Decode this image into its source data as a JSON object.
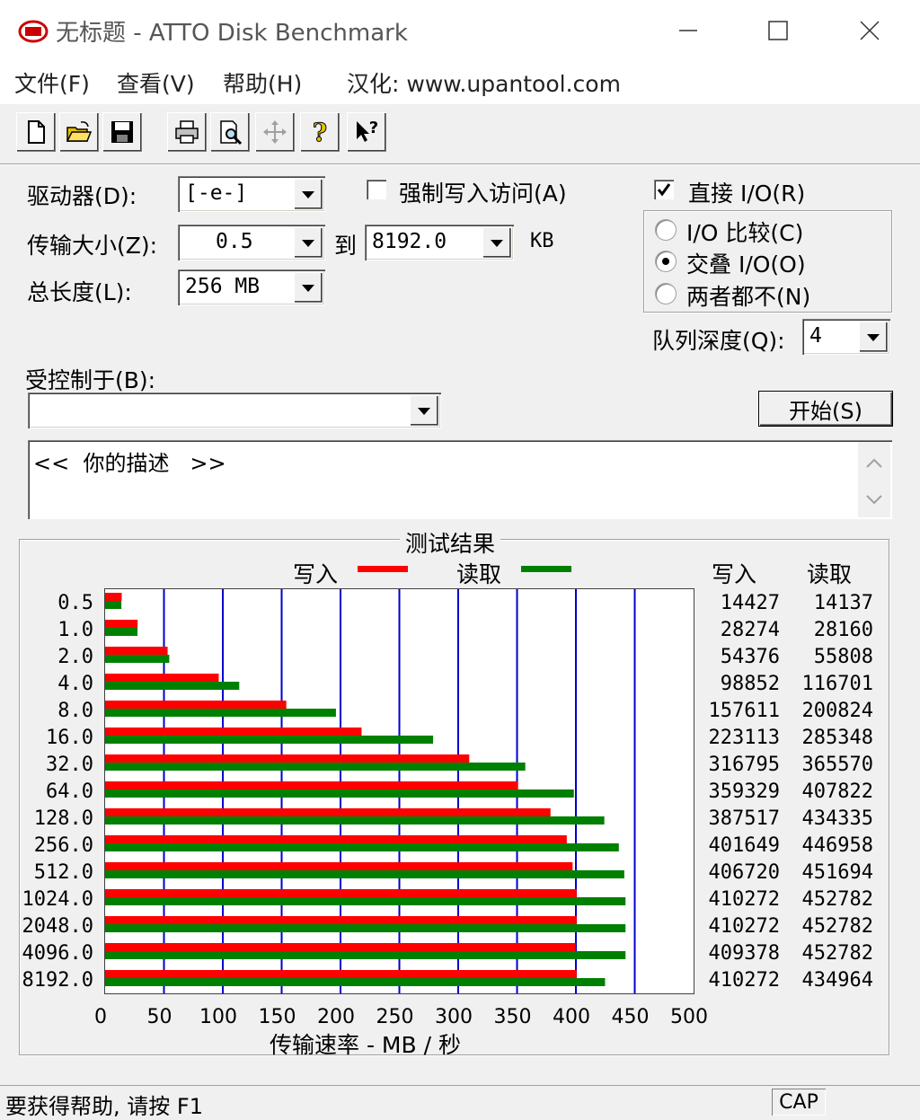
{
  "window": {
    "title": "无标题 - ATTO Disk Benchmark"
  },
  "menu": {
    "items": [
      "文件(F)",
      "查看(V)",
      "帮助(H)"
    ],
    "localized": "汉化: www.upantool.com"
  },
  "form": {
    "drive_label": "驱动器(D):",
    "drive_value": "[-e-]",
    "force_write_label": "强制写入访问(A)",
    "direct_io_label": "直接 I/O(R)",
    "transfer_label": "传输大小(Z):",
    "transfer_from": "0.5",
    "to_label": "到",
    "transfer_to": "8192.0",
    "kb_label": "KB",
    "total_label": "总长度(L):",
    "total_value": "256 MB",
    "io_compare_label": "I/O 比较(C)",
    "overlap_label": "交叠 I/O(O)",
    "neither_label": "两者都不(N)",
    "queue_label": "队列深度(Q):",
    "queue_value": "4",
    "controlled_label": "受控制于(B):",
    "controlled_value": "",
    "start_label": "开始(S)",
    "description": "<<  你的描述   >>"
  },
  "results": {
    "title": "测试结果",
    "write_legend": "写入",
    "read_legend": "读取",
    "write_header": "写入",
    "read_header": "读取",
    "xlabel": "传输速率 - MB / 秒"
  },
  "chart_data": {
    "type": "bar",
    "orientation": "horizontal",
    "categories": [
      "0.5",
      "1.0",
      "2.0",
      "4.0",
      "8.0",
      "16.0",
      "32.0",
      "64.0",
      "128.0",
      "256.0",
      "512.0",
      "1024.0",
      "2048.0",
      "4096.0",
      "8192.0"
    ],
    "series": [
      {
        "name": "写入",
        "color": "#ff0000",
        "values": [
          14427,
          28274,
          54376,
          98852,
          157611,
          223113,
          316795,
          359329,
          387517,
          401649,
          406720,
          410272,
          410272,
          409378,
          410272
        ]
      },
      {
        "name": "读取",
        "color": "#008000",
        "values": [
          14137,
          28160,
          55808,
          116701,
          200824,
          285348,
          365570,
          407822,
          434335,
          446958,
          451694,
          452782,
          452782,
          452782,
          434964
        ]
      }
    ],
    "xticks": [
      0,
      50,
      100,
      150,
      200,
      250,
      300,
      350,
      400,
      450,
      500
    ],
    "xlim": [
      0,
      500
    ],
    "xlabel": "传输速率 - MB / 秒"
  },
  "statusbar": {
    "text": "要获得帮助, 请按 F1",
    "cap": "CAP"
  },
  "colors": {
    "write": "#ff0000",
    "read": "#008000",
    "grid": "#0000cc"
  }
}
